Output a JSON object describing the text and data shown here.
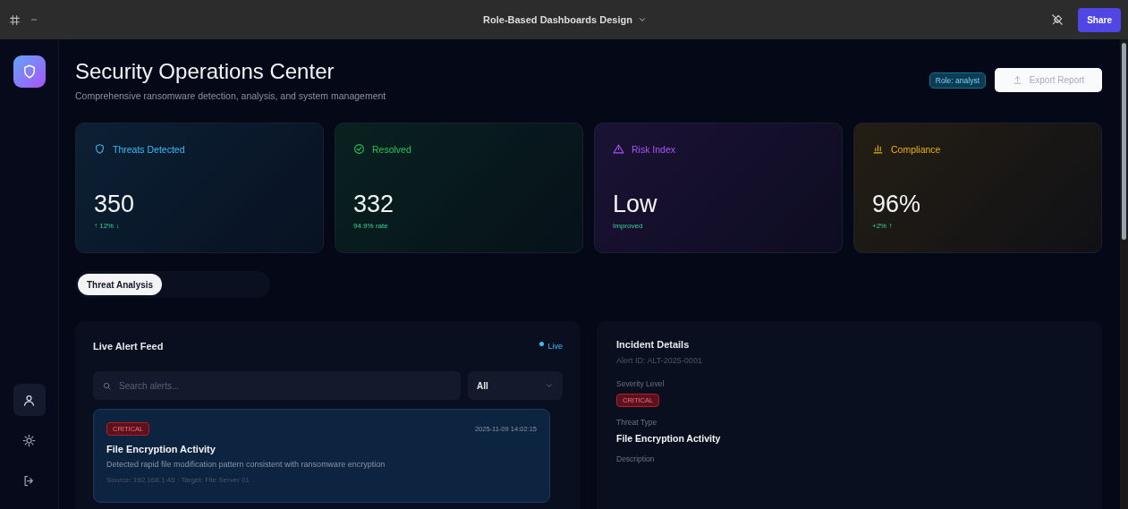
{
  "topbar": {
    "title": "Role-Based Dashboards Design",
    "share": "Share"
  },
  "sidebar": {
    "items": [
      {
        "kind": "user",
        "selected": true
      },
      {
        "kind": "settings",
        "selected": false
      },
      {
        "kind": "logout",
        "selected": false
      }
    ]
  },
  "header": {
    "title": "Security Operations Center",
    "subtitle": "Comprehensive ransomware detection, analysis, and system management",
    "role_badge": "Role: analyst",
    "export_button": "Export Report"
  },
  "stats": [
    {
      "kind": "threats",
      "label": "Threats Detected",
      "value": "350",
      "change": "↑ 12% ↓",
      "color": "#38bdf8"
    },
    {
      "kind": "resolved",
      "label": "Resolved",
      "value": "332",
      "change": "94.9% rate",
      "color": "#22c55e"
    },
    {
      "kind": "risk",
      "label": "Risk Index",
      "value": "Low",
      "change": "Improved",
      "color": "#a855f7"
    },
    {
      "kind": "compliance",
      "label": "Compliance",
      "value": "96%",
      "change": "+2% ↑",
      "color": "#eab308"
    }
  ],
  "tabs": [
    {
      "label": "Threat Analysis",
      "selected": true
    }
  ],
  "alert_feed": {
    "title": "Live Alert Feed",
    "live": "Live",
    "search": {
      "placeholder": "Search alerts..."
    },
    "filter": "All",
    "alerts": [
      {
        "severity": "CRITICAL",
        "time": "2025-11-09 14:02:15",
        "title": "File Encryption Activity",
        "description": "Detected rapid file modification pattern consistent with ransomware encryption",
        "meta": "Source: 192.168.1.45 · Target: File Server 01",
        "selected": true
      }
    ]
  },
  "incident": {
    "title": "Incident Details",
    "alert_id": "Alert ID: ALT-2025-0001",
    "fields": [
      {
        "kind": "badge",
        "label": "Severity Level",
        "value": "CRITICAL"
      },
      {
        "kind": "text",
        "label": "Threat Type",
        "value": "File Encryption Activity"
      },
      {
        "kind": "label",
        "label": "Description"
      }
    ]
  }
}
